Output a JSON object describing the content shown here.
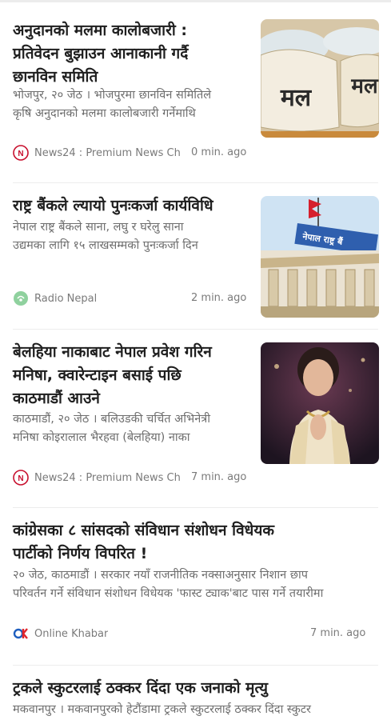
{
  "articles": [
    {
      "title_lines": [
        "अनुदानको मलमा कालोबजारी :",
        "प्रतिवेदन बुझाउन आनाकानी गर्दै",
        "छानविन समिति"
      ],
      "snippet_lines": [
        "भोजपुर, २० जेठ । भोजपुरमा छानविन समितिले",
        "कृषि अनुदानको मलमा कालोबजारी गर्नेमाथि"
      ],
      "source": "News24 : Premium News Ch...",
      "time": "0 min. ago",
      "image_text": "मल",
      "image_text2": "मल"
    },
    {
      "title_lines": [
        "राष्ट्र बैंकले ल्यायो पुनःकर्जा कार्यविधि"
      ],
      "snippet_lines": [
        "नेपाल राष्ट्र बैंकले साना, लघु र घरेलु साना",
        "उद्यमका लागि १५ लाखसम्मको पुनःकर्जा दिन"
      ],
      "source": "Radio Nepal",
      "time": "2 min. ago",
      "image_text": "नेपाल राष्ट्र बैं"
    },
    {
      "title_lines": [
        "बेलहिया नाकाबाट नेपाल प्रवेश गरिन",
        "मनिषा, क्वारेन्टाइन बसाई पछि",
        "काठमाडौं आउने"
      ],
      "snippet_lines": [
        "काठमाडौं, २० जेठ । बलिउडकी चर्चित अभिनेत्री",
        "मनिषा कोइरालाल भैरहवा (बेलहिया) नाका"
      ],
      "source": "News24 : Premium News Ch...",
      "time": "7 min. ago"
    },
    {
      "title_lines": [
        "कांग्रेसका ८ सांसदको संविधान संशोधन विधेयक",
        "पार्टीको निर्णय विपरित !"
      ],
      "snippet_lines": [
        "२० जेठ, काठमाडौं । सरकार नयाँ राजनीतिक नक्साअनुसार निशान छाप",
        "परिवर्तन गर्ने संविधान संशोधन विधेयक 'फास्ट ट्याक'बाट पास गर्ने तयारीमा"
      ],
      "source": "Online Khabar",
      "time": "7 min. ago"
    },
    {
      "title_lines": [
        "ट्रकले स्कुटरलाई ठक्कर दिंदा एक जनाको मृत्यु"
      ],
      "snippet_lines": [
        "मकवानपुर । मकवानपुरको हेटौंडामा ट्रकले स्कुटरलाई ठक्कर दिंदा स्कुटर"
      ]
    }
  ],
  "colors": {
    "title": "#1f1f1f",
    "snippet": "#6d6d6d",
    "meta": "#7a7a7a",
    "news24_logo": "#c8102e",
    "radio_logo": "#8fd19e",
    "okhabar_blue": "#1f5fbf",
    "okhabar_red": "#e0252b"
  },
  "icons": {
    "news24": "news24-logo-icon",
    "radio_nepal": "radio-nepal-logo-icon",
    "online_khabar": "online-khabar-logo-icon"
  }
}
